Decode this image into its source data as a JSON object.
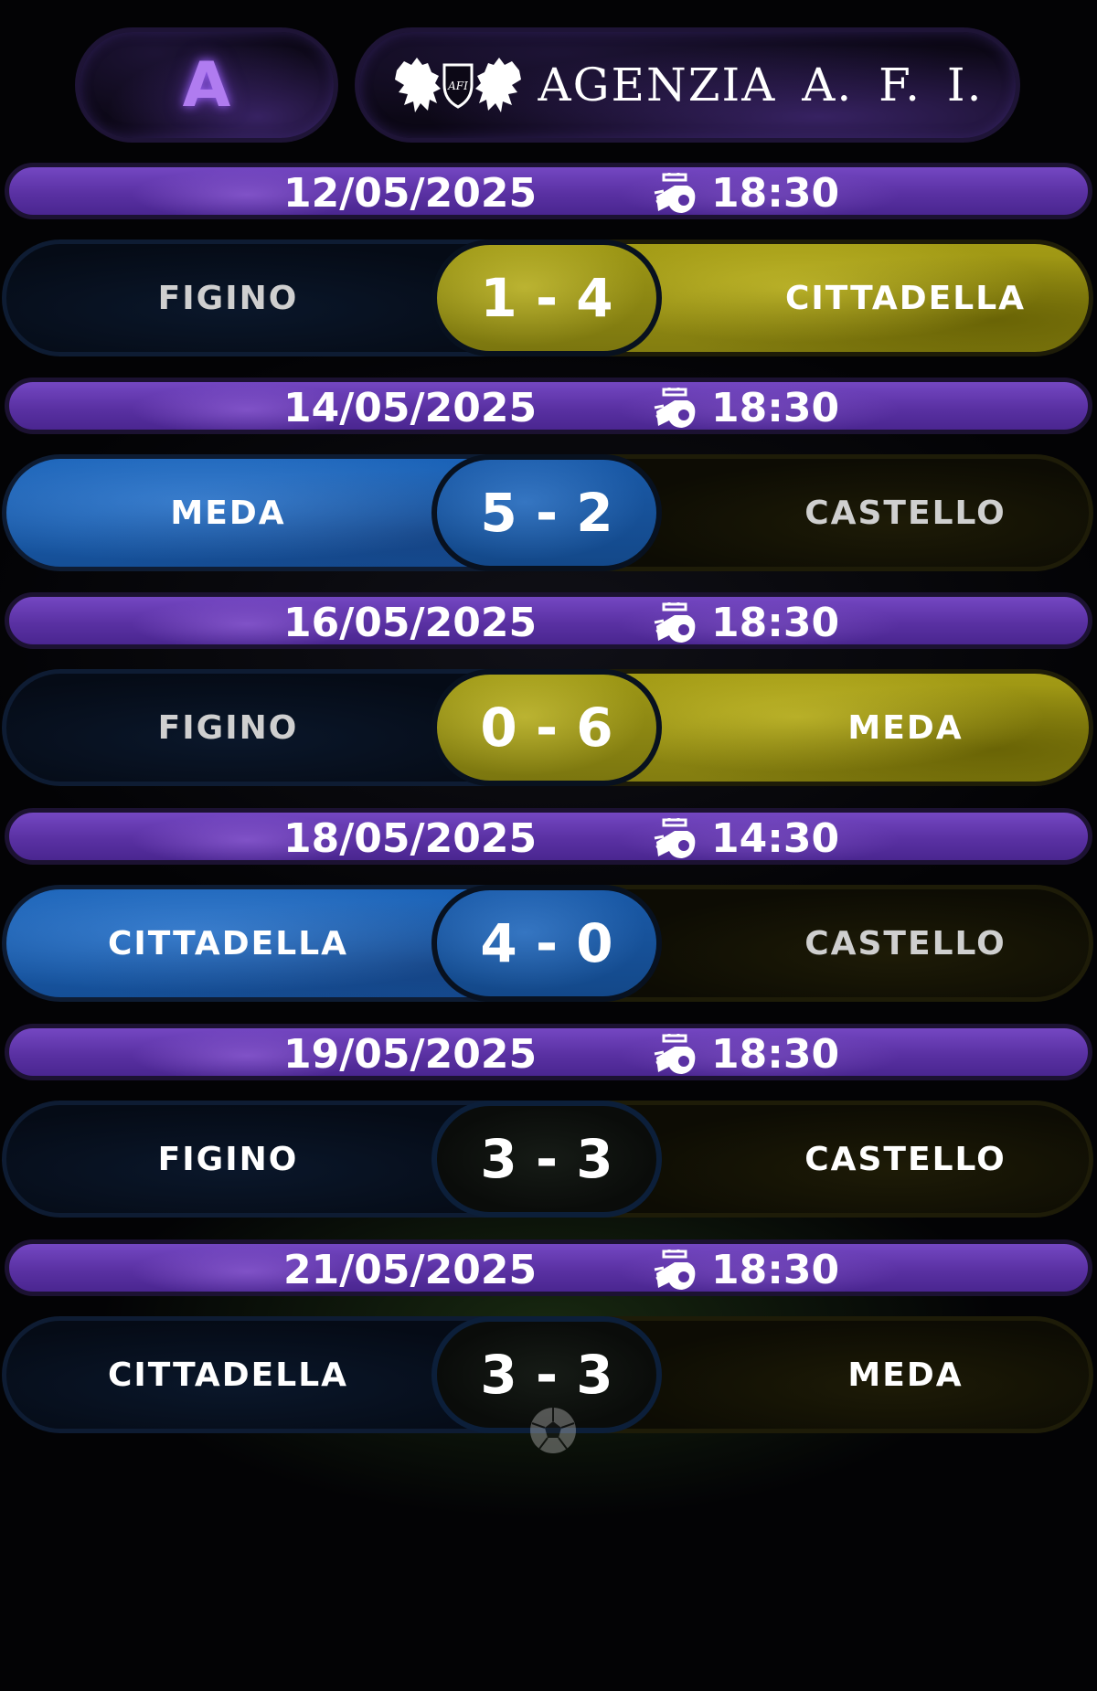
{
  "header": {
    "series_letter": "A",
    "brand_name": "AGENZIA A. F. I.",
    "logo_icon": "lions-crest-logo"
  },
  "colors": {
    "date_bar": "#5a31a3",
    "blue_team": "#1b63b8",
    "yellow_team": "#a39b15",
    "series_letter": "#b07cf0"
  },
  "matches": [
    {
      "date": "12/05/2025",
      "time": "18:30",
      "home": "FIGINO",
      "away": "CITTADELLA",
      "score": "1 - 4",
      "home_style": "dark",
      "away_style": "yellow",
      "score_style": "yellow",
      "home_dim": true,
      "away_dim": false
    },
    {
      "date": "14/05/2025",
      "time": "18:30",
      "home": "MEDA",
      "away": "CASTELLO",
      "score": "5 - 2",
      "home_style": "blue",
      "away_style": "dark",
      "score_style": "blue",
      "home_dim": false,
      "away_dim": true
    },
    {
      "date": "16/05/2025",
      "time": "18:30",
      "home": "FIGINO",
      "away": "MEDA",
      "score": "0 - 6",
      "home_style": "dark",
      "away_style": "yellow",
      "score_style": "yellow",
      "home_dim": true,
      "away_dim": false
    },
    {
      "date": "18/05/2025",
      "time": "14:30",
      "home": "CITTADELLA",
      "away": "CASTELLO",
      "score": "4 - 0",
      "home_style": "blue",
      "away_style": "dark",
      "score_style": "blue",
      "home_dim": false,
      "away_dim": true
    },
    {
      "date": "19/05/2025",
      "time": "18:30",
      "home": "FIGINO",
      "away": "CASTELLO",
      "score": "3 - 3",
      "home_style": "dark",
      "away_style": "dark",
      "score_style": "dark",
      "home_dim": false,
      "away_dim": false
    },
    {
      "date": "21/05/2025",
      "time": "18:30",
      "home": "CITTADELLA",
      "away": "MEDA",
      "score": "3 - 3",
      "home_style": "dark",
      "away_style": "dark",
      "score_style": "dark",
      "home_dim": false,
      "away_dim": false
    }
  ]
}
